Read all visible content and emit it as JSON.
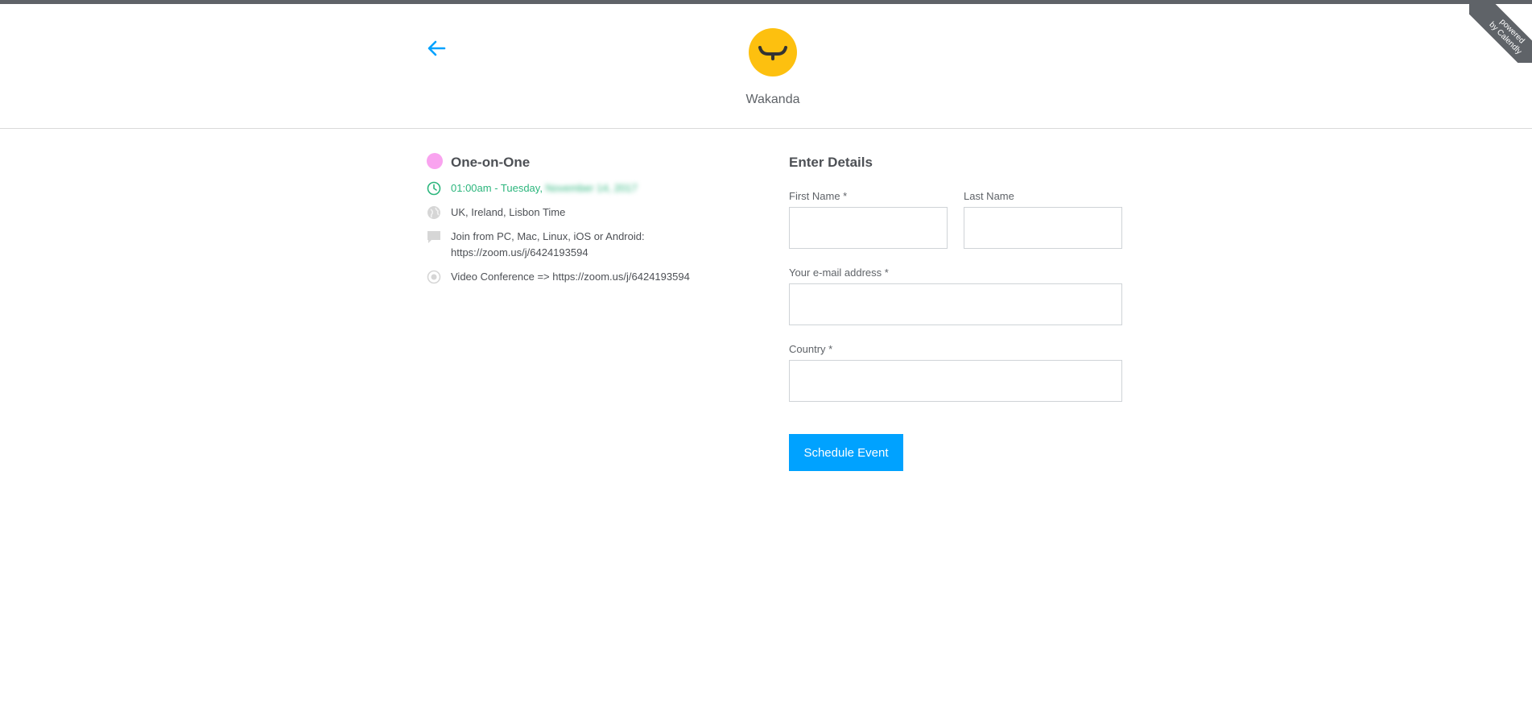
{
  "branding": {
    "ribbon_line1": "powered",
    "ribbon_line2": "by Calendly"
  },
  "header": {
    "org_name": "Wakanda",
    "logo_icon": "wakanda-logo-icon",
    "back_icon": "arrow-left-icon",
    "accent_color": "#00a2ff",
    "logo_color": "#fdc00f"
  },
  "event": {
    "title": "One-on-One",
    "color": "#f9a3ef",
    "time_prefix": "01:00am - Tuesday, ",
    "time_date_blurred": "November 14, 2017",
    "timezone": "UK, Ireland, Lisbon Time",
    "join_line1": "Join from PC, Mac, Linux, iOS or Android:",
    "join_line2": "https://zoom.us/j/6424193594",
    "video_conference": "Video Conference => https://zoom.us/j/6424193594",
    "icons": {
      "time": "clock-icon",
      "timezone": "globe-icon",
      "join": "comment-icon",
      "video": "location-icon"
    }
  },
  "form": {
    "title": "Enter Details",
    "first_name_label": "First Name *",
    "first_name_value": "",
    "last_name_label": "Last Name",
    "last_name_value": "",
    "email_label": "Your e-mail address *",
    "email_value": "",
    "country_label": "Country *",
    "country_value": "",
    "submit_label": "Schedule Event"
  }
}
